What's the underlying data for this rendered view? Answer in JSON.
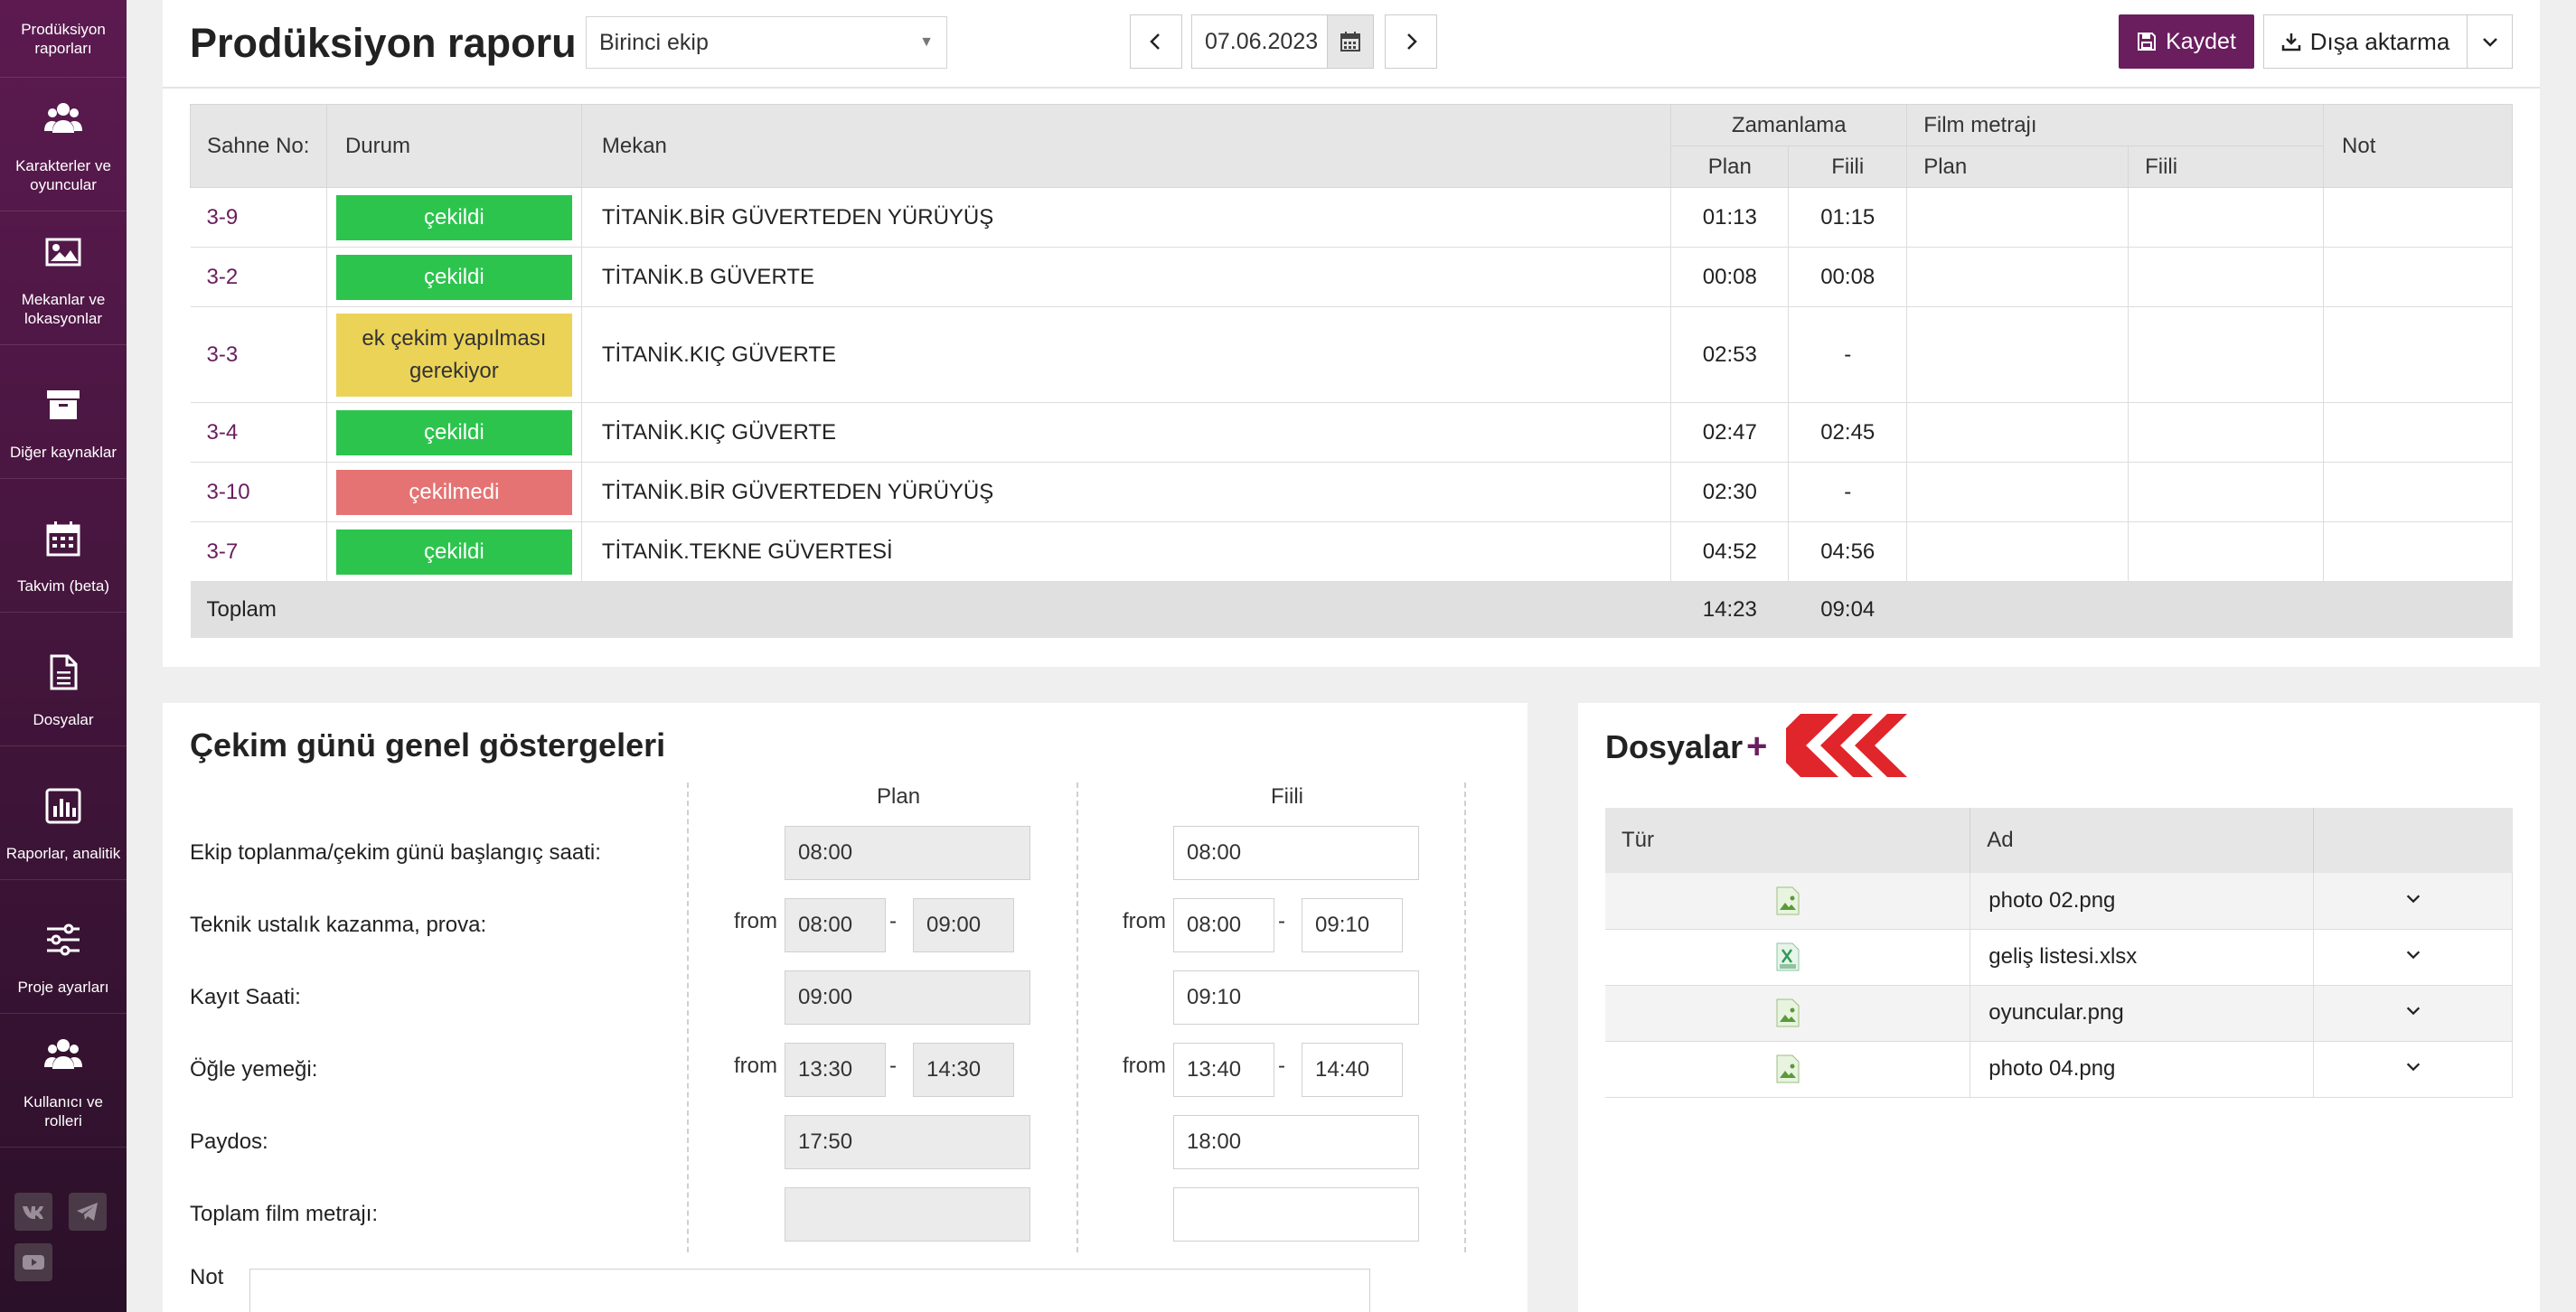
{
  "sidebar": {
    "items": [
      {
        "label": "Prodüksiyon raporları",
        "icon": "report-icon"
      },
      {
        "label": "Karakterler ve oyuncular",
        "icon": "users-icon"
      },
      {
        "label": "Mekanlar ve lokasyonlar",
        "icon": "image-icon"
      },
      {
        "label": "Diğer kaynaklar",
        "icon": "archive-icon"
      },
      {
        "label": "Takvim (beta)",
        "icon": "calendar-icon"
      },
      {
        "label": "Dosyalar",
        "icon": "file-icon"
      },
      {
        "label": "Raporlar, analitik",
        "icon": "chart-icon"
      },
      {
        "label": "Proje ayarları",
        "icon": "sliders-icon"
      },
      {
        "label": "Kullanıcı ve rolleri",
        "icon": "users-icon"
      }
    ],
    "social": [
      "vk-icon",
      "telegram-icon",
      "youtube-icon"
    ]
  },
  "header": {
    "title": "Prodüksiyon raporu",
    "crew_select": "Birinci ekip",
    "date": "07.06.2023",
    "save_label": "Kaydet",
    "export_label": "Dışa aktarma"
  },
  "scenes": {
    "headers": {
      "scene_no": "Sahne No:",
      "status": "Durum",
      "location": "Mekan",
      "timing": "Zamanlama",
      "film": "Film metrajı",
      "note": "Not",
      "plan": "Plan",
      "actual": "Fiili"
    },
    "rows": [
      {
        "no": "3-9",
        "status": "çekildi",
        "status_type": "green",
        "location": "TİTANİK.BİR GÜVERTEDEN YÜRÜYÜŞ",
        "plan": "01:13",
        "actual": "01:15"
      },
      {
        "no": "3-2",
        "status": "çekildi",
        "status_type": "green",
        "location": "TİTANİK.B GÜVERTE",
        "plan": "00:08",
        "actual": "00:08"
      },
      {
        "no": "3-3",
        "status": "ek çekim yapılması gerekiyor",
        "status_type": "yellow",
        "location": "TİTANİK.KIÇ GÜVERTE",
        "plan": "02:53",
        "actual": "-"
      },
      {
        "no": "3-4",
        "status": "çekildi",
        "status_type": "green",
        "location": "TİTANİK.KIÇ GÜVERTE",
        "plan": "02:47",
        "actual": "02:45"
      },
      {
        "no": "3-10",
        "status": "çekilmedi",
        "status_type": "red",
        "location": "TİTANİK.BİR GÜVERTEDEN YÜRÜYÜŞ",
        "plan": "02:30",
        "actual": "-"
      },
      {
        "no": "3-7",
        "status": "çekildi",
        "status_type": "green",
        "location": "TİTANİK.TEKNE GÜVERTESİ",
        "plan": "04:52",
        "actual": "04:56"
      }
    ],
    "total": {
      "label": "Toplam",
      "plan": "14:23",
      "actual": "09:04"
    }
  },
  "indicators": {
    "title": "Çekim günü genel göstergeleri",
    "plan_header": "Plan",
    "actual_header": "Fiili",
    "from": "from",
    "dash": "-",
    "rows": {
      "crew_call": {
        "label": "Ekip toplanma/çekim günü başlangıç saati:",
        "plan": "08:00",
        "actual": "08:00"
      },
      "technical": {
        "label": "Teknik ustalık kazanma, prova:",
        "plan_from": "08:00",
        "plan_to": "09:00",
        "actual_from": "08:00",
        "actual_to": "09:10"
      },
      "record": {
        "label": "Kayıt Saati:",
        "plan": "09:00",
        "actual": "09:10"
      },
      "lunch": {
        "label": "Öğle yemeği:",
        "plan_from": "13:30",
        "plan_to": "14:30",
        "actual_from": "13:40",
        "actual_to": "14:40"
      },
      "wrap": {
        "label": "Paydos:",
        "plan": "17:50",
        "actual": "18:00"
      },
      "film_total": {
        "label": "Toplam film metrajı:",
        "plan": "",
        "actual": ""
      }
    },
    "note_label": "Not"
  },
  "files": {
    "title": "Dosyalar",
    "add": "+",
    "headers": {
      "type": "Tür",
      "name": "Ad"
    },
    "rows": [
      {
        "name": "photo 02.png",
        "icon": "png-file-icon"
      },
      {
        "name": "geliş listesi.xlsx",
        "icon": "xlsx-file-icon"
      },
      {
        "name": "oyuncular.png",
        "icon": "png-file-icon"
      },
      {
        "name": "photo 04.png",
        "icon": "png-file-icon"
      }
    ]
  },
  "colors": {
    "brand": "#6a1e5e",
    "status_green": "#2dc44e",
    "status_red": "#e57373",
    "status_yellow": "#ebd358",
    "logo_red": "#e0252b"
  }
}
